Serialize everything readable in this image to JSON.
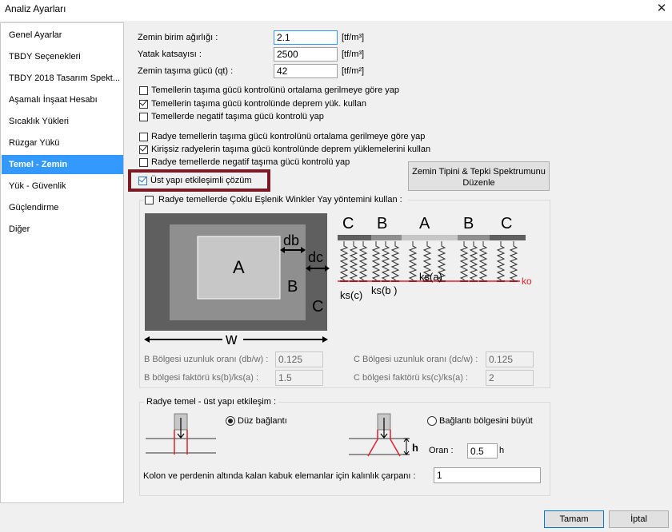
{
  "window": {
    "title": "Analiz Ayarları",
    "close": "✕"
  },
  "sidebar": {
    "items": [
      {
        "label": "Genel Ayarlar"
      },
      {
        "label": "TBDY Seçenekleri"
      },
      {
        "label": "TBDY 2018 Tasarım Spekt..."
      },
      {
        "label": "Aşamalı İnşaat Hesabı"
      },
      {
        "label": "Sıcaklık Yükleri"
      },
      {
        "label": "Rüzgar Yükü"
      },
      {
        "label": "Temel - Zemin"
      },
      {
        "label": "Yük - Güvenlik"
      },
      {
        "label": "Güçlendirme"
      },
      {
        "label": "Diğer"
      }
    ],
    "selected": "Temel - Zemin"
  },
  "params": {
    "unit_weight_label": "Zemin birim ağırlığı :",
    "unit_weight_value": "2.1",
    "unit_weight_unit": "[tf/m³]",
    "subgrade_label": "Yatak katsayısı :",
    "subgrade_value": "2500",
    "subgrade_unit": "[tf/m³]",
    "bearing_label": "Zemin taşıma gücü (qt) :",
    "bearing_value": "42",
    "bearing_unit": "[tf/m²]"
  },
  "checks": {
    "c1": {
      "label": "Temellerin taşıma gücü kontrolünü ortalama gerilmeye göre yap",
      "checked": false
    },
    "c2": {
      "label": "Temellerin taşıma gücü kontrolünde deprem yük. kullan",
      "checked": true
    },
    "c3": {
      "label": "Temellerde negatif taşıma gücü kontrolü yap",
      "checked": false
    },
    "c4": {
      "label": "Radye temellerin taşıma gücü kontrolünü ortalama gerilmeye göre yap",
      "checked": false
    },
    "c5": {
      "label": "Kirişsiz radyelerin taşıma gücü kontrolünde deprem yüklemelerini kullan",
      "checked": true
    },
    "c6": {
      "label": "Radye temellerde negatif taşıma gücü kontrolü yap",
      "checked": false
    },
    "c7": {
      "label": "Üst yapı etkileşimli çözüm",
      "checked": true
    },
    "c8": {
      "label": "Radye temellerde Çoklu Eşlenik Winkler Yay yöntemini kullan :",
      "checked": false
    }
  },
  "spectrum_button": {
    "line1": "Zemin Tipini  & Tepki Spektrumunu",
    "line2": "Düzenle"
  },
  "winkler": {
    "diagram": {
      "A": "A",
      "B": "B",
      "C": "C",
      "db": "db",
      "dc": "dc",
      "w": "w"
    },
    "section": {
      "labels": [
        "C",
        "B",
        "A",
        "B",
        "C"
      ],
      "ks_c": "ks(c)",
      "ks_b": "ks(b )",
      "ks_a": "ks(a)",
      "ko": "ko"
    },
    "b_ratio_label": "B Bölgesi uzunluk oranı (db/w) :",
    "b_ratio_value": "0.125",
    "c_ratio_label": "C Bölgesi uzunluk oranı (dc/w) :",
    "c_ratio_value": "0.125",
    "b_factor_label": "B bölgesi faktörü ks(b)/ks(a) :",
    "b_factor_value": "1.5",
    "c_factor_label": "C bölgesi faktörü ks(c)/ks(a) :",
    "c_factor_value": "2"
  },
  "raft": {
    "group_label": "Radye temel - üst yapı etkileşim :",
    "option1": "Düz bağlantı",
    "option1_selected": true,
    "option2": "Bağlantı bölgesini büyüt",
    "option2_selected": false,
    "h_label": "h",
    "oran_label": "Oran :",
    "oran_value": "0.5",
    "oran_unit": "h",
    "thickness_label": "Kolon ve perdenin altında kalan kabuk elemanlar için kalınlık çarpanı :",
    "thickness_value": "1"
  },
  "footer": {
    "ok": "Tamam",
    "cancel": "İptal"
  },
  "colors": {
    "selection": "#3399ff",
    "highlight_frame": "#7b1a24",
    "red_line": "#e0202a",
    "diagram_dark": "#5f5f5f",
    "diagram_mid": "#8f8f8f",
    "diagram_light": "#c7c7c7"
  }
}
